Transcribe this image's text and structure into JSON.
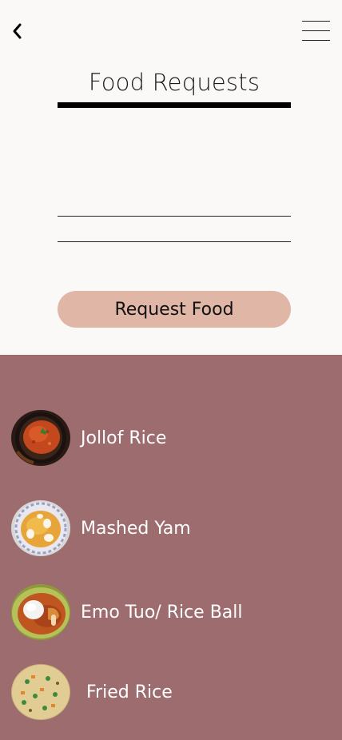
{
  "header": {
    "back_icon": "chevron-left-icon",
    "menu_icon": "hamburger-menu-icon",
    "title": "Food Requests"
  },
  "form": {
    "field1_value": "",
    "field2_value": "",
    "submit_label": "Request Food"
  },
  "food_list": [
    {
      "label": "Jollof Rice",
      "image": "jollof-rice-image"
    },
    {
      "label": "Mashed Yam",
      "image": "mashed-yam-image"
    },
    {
      "label": "Emo Tuo/ Rice Ball",
      "image": "emo-tuo-image"
    },
    {
      "label": "Fried Rice",
      "image": "fried-rice-image"
    }
  ],
  "colors": {
    "background": "#fbf9f8",
    "list_background": "#9c6c6e",
    "button_background": "#e0b7a7",
    "text_dark": "#1a1a1a",
    "text_light": "#ffffff"
  }
}
